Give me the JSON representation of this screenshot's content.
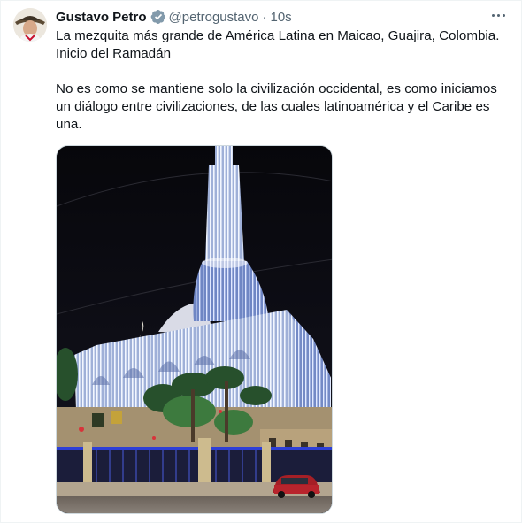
{
  "tweet": {
    "author_name": "Gustavo Petro",
    "handle": "@petrogustavo",
    "separator": "·",
    "time": "10s",
    "lines": [
      "La mezquita más grande de América Latina en Maicao, Guajira, Colombia.",
      "Inicio del Ramadán",
      "No es como se mantiene solo la civilización occidental, es como iniciamos",
      "un diálogo entre civilizaciones, de las cuales latinoamérica y el Caribe es",
      "una."
    ]
  },
  "icons": {
    "verified": "verified-badge-icon",
    "more": "more-options-icon"
  },
  "colors": {
    "text": "#0f1419",
    "secondary": "#536471",
    "verified_badge": "#829aab",
    "border": "#cfd9de"
  }
}
